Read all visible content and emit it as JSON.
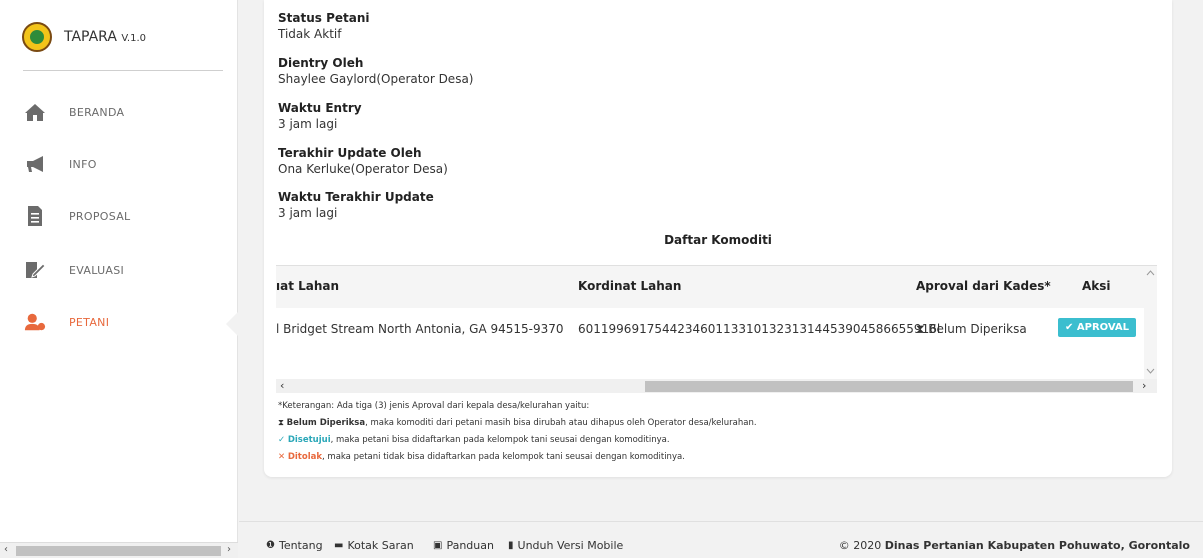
{
  "app": {
    "name": "TAPARA",
    "version": "V.1.0"
  },
  "sidebar": {
    "items": [
      {
        "label": "BERANDA",
        "icon": "home-icon"
      },
      {
        "label": "INFO",
        "icon": "megaphone-icon"
      },
      {
        "label": "PROPOSAL",
        "icon": "document-icon"
      },
      {
        "label": "EVALUASI",
        "icon": "evaluation-icon"
      },
      {
        "label": "PETANI",
        "icon": "farmer-icon",
        "active": true
      }
    ]
  },
  "detail": {
    "fields": [
      {
        "label": "Status Petani",
        "value": "Tidak Aktif"
      },
      {
        "label": "Dientry Oleh",
        "value": "Shaylee Gaylord(Operator Desa)"
      },
      {
        "label": "Waktu Entry",
        "value": "3 jam lagi"
      },
      {
        "label": "Terakhir Update Oleh",
        "value": "Ona Kerluke(Operator Desa)"
      },
      {
        "label": "Waktu Terakhir Update",
        "value": "3 jam lagi"
      }
    ]
  },
  "komoditi": {
    "title": "Daftar Komoditi",
    "columns": [
      "ıat Lahan",
      "Kordinat Lahan",
      "Aproval dari Kades*",
      "Aksi"
    ],
    "rows": [
      {
        "alamat": "l Bridget Stream North Antonia, GA 94515-9370",
        "kordinat": "60119969175442346011331013231314453904586655916l",
        "status": "Belum Diperiksa",
        "action": "APROVAL"
      }
    ]
  },
  "notes": {
    "intro": "*Keterangan: Ada tiga (3) jenis Aproval dari kepala desa/kelurahan yaitu:",
    "belum_label": "Belum Diperiksa",
    "belum_text": ", maka komoditi dari petani masih bisa dirubah atau dihapus oleh Operator desa/kelurahan.",
    "disetujui_label": "Disetujui",
    "disetujui_text": ", maka petani bisa didaftarkan pada kelompok tani seusai dengan komoditinya.",
    "ditolak_label": "Ditolak",
    "ditolak_text": ", maka petani tidak bisa didaftarkan pada kelompok tani seusai dengan komoditinya."
  },
  "footer": {
    "links": [
      "Tentang",
      "Kotak Saran",
      "Panduan",
      "Unduh Versi Mobile"
    ],
    "copyright_prefix": "© 2020 ",
    "copyright_org": "Dinas Pertanian Kabupaten Pohuwato, Gorontalo"
  },
  "colors": {
    "accent": "#e8693d",
    "teal": "#3bbecf"
  }
}
